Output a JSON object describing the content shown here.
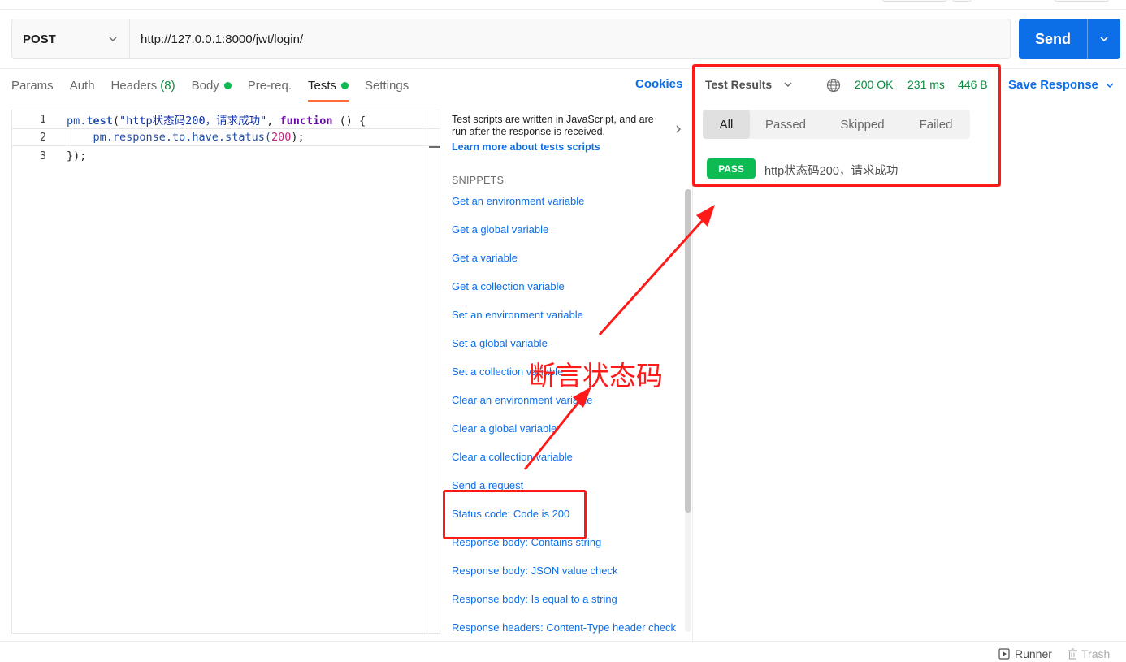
{
  "request": {
    "method": "POST",
    "url": "http://127.0.0.1:8000/jwt/login/",
    "send_label": "Send"
  },
  "tabs": [
    {
      "label": "Params",
      "count": "",
      "dot": false,
      "active": false
    },
    {
      "label": "Auth",
      "count": "",
      "dot": false,
      "active": false
    },
    {
      "label": "Headers",
      "count": "(8)",
      "dot": false,
      "active": false
    },
    {
      "label": "Body",
      "count": "",
      "dot": true,
      "active": false
    },
    {
      "label": "Pre-req.",
      "count": "",
      "dot": false,
      "active": false
    },
    {
      "label": "Tests",
      "count": "",
      "dot": true,
      "active": true
    },
    {
      "label": "Settings",
      "count": "",
      "dot": false,
      "active": false
    }
  ],
  "cookies_label": "Cookies",
  "editor": {
    "line_numbers": [
      "1",
      "2",
      "3"
    ],
    "line1": {
      "obj": "pm.",
      "method": "test",
      "open": "(",
      "str": "\"http状态码200，请求成功\"",
      "comma": ", ",
      "kw": "function",
      "rest": " () {"
    },
    "line2": {
      "pre": "    pm.response.to.have.status(",
      "num": "200",
      "post": ");"
    },
    "line3": "});"
  },
  "snippets": {
    "intro": "Test scripts are written in JavaScript, and are run after the response is received.",
    "learn_more": "Learn more about tests scripts",
    "title": "SNIPPETS",
    "items": [
      "Get an environment variable",
      "Get a global variable",
      "Get a variable",
      "Get a collection variable",
      "Set an environment variable",
      "Set a global variable",
      "Set a collection variable",
      "Clear an environment variable",
      "Clear a global variable",
      "Clear a collection variable",
      "Send a request",
      "Status code: Code is 200",
      "Response body: Contains string",
      "Response body: JSON value check",
      "Response body: Is equal to a string",
      "Response headers: Content-Type header check"
    ]
  },
  "response": {
    "results_label": "Test Results",
    "status": "200 OK",
    "time": "231 ms",
    "size": "446 B",
    "save_label": "Save Response",
    "filters": [
      "All",
      "Passed",
      "Skipped",
      "Failed"
    ],
    "active_filter": "All",
    "result": {
      "badge": "PASS",
      "name": "http状态码200，请求成功"
    }
  },
  "annotation": {
    "text": "断言状态码",
    "color": "#ff1a1a"
  },
  "footer": {
    "runner": "Runner",
    "trash": "Trash"
  },
  "colors": {
    "accent_blue": "#0d6fe8",
    "pass_green": "#0cbb52",
    "tab_underline": "#ff6c37"
  }
}
